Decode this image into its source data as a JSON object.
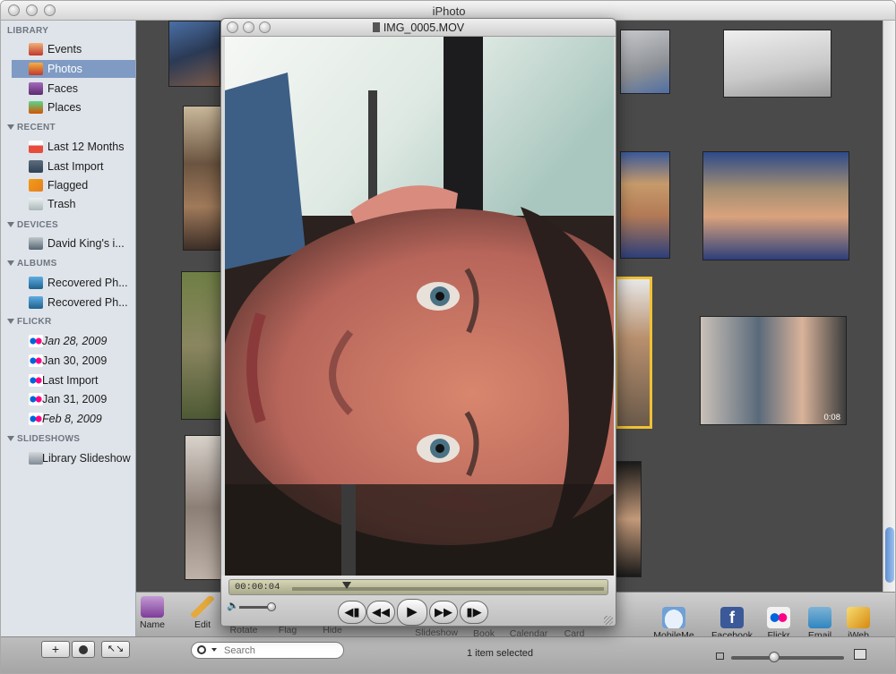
{
  "window": {
    "title": "iPhoto"
  },
  "sidebar": {
    "sections": [
      {
        "label": "LIBRARY"
      },
      {
        "label": "RECENT"
      },
      {
        "label": "DEVICES"
      },
      {
        "label": "ALBUMS"
      },
      {
        "label": "FLICKR"
      },
      {
        "label": "SLIDESHOWS"
      }
    ],
    "library": [
      {
        "label": "Events",
        "icon": "events-icon"
      },
      {
        "label": "Photos",
        "icon": "photos-icon"
      },
      {
        "label": "Faces",
        "icon": "faces-icon"
      },
      {
        "label": "Places",
        "icon": "places-icon"
      }
    ],
    "recent": [
      {
        "label": "Last 12 Months",
        "icon": "calendar-icon"
      },
      {
        "label": "Last Import",
        "icon": "import-icon"
      },
      {
        "label": "Flagged",
        "icon": "flag-icon"
      },
      {
        "label": "Trash",
        "icon": "trash-icon"
      }
    ],
    "devices": [
      {
        "label": "David King's i...",
        "icon": "camera-icon"
      }
    ],
    "albums": [
      {
        "label": "Recovered Ph...",
        "icon": "album-icon"
      },
      {
        "label": "Recovered Ph...",
        "icon": "album-icon"
      }
    ],
    "flickr": [
      {
        "label": "Jan 28, 2009",
        "icon": "flickr-icon"
      },
      {
        "label": "Jan 30, 2009",
        "icon": "flickr-icon"
      },
      {
        "label": "Last Import",
        "icon": "flickr-icon"
      },
      {
        "label": "Jan 31, 2009",
        "icon": "flickr-icon"
      },
      {
        "label": "Feb 8, 2009",
        "icon": "flickr-icon"
      }
    ],
    "slideshows": [
      {
        "label": "Library Slideshow",
        "icon": "slideshow-icon"
      }
    ]
  },
  "toolbar": {
    "name": "Name",
    "edit": "Edit",
    "rotate": "Rotate",
    "flag": "Flag",
    "hide": "Hide",
    "slideshow": "Slideshow",
    "book": "Book",
    "calendar": "Calendar",
    "card": "Card",
    "mobileme": "MobileMe",
    "facebook": "Facebook",
    "flickr": "Flickr",
    "email": "Email",
    "iweb": "iWeb"
  },
  "bottombar": {
    "add": "+",
    "search_placeholder": "Search",
    "status": "1 item selected"
  },
  "grid": {
    "video_duration": "0:08"
  },
  "player": {
    "title": "IMG_0005.MOV",
    "timecode": "00:00:04"
  },
  "colors": {
    "selection": "#7f9bc4",
    "sidebar_bg": "#dfe4ea",
    "grid_bg": "#4a4a4a",
    "selected_border": "#f1c232"
  }
}
